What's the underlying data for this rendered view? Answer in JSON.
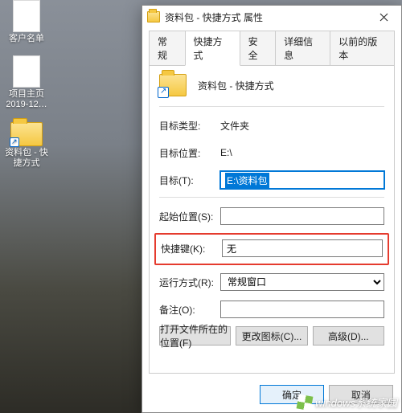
{
  "desktop": {
    "icons": [
      {
        "label": "客户名单"
      },
      {
        "label": "项目主页\n2019-12…"
      },
      {
        "label": "资料包 - 快\n捷方式"
      }
    ]
  },
  "dialog": {
    "title": "资料包 - 快捷方式 属性",
    "tabs": [
      "常规",
      "快捷方式",
      "安全",
      "详细信息",
      "以前的版本"
    ],
    "active_tab_index": 1,
    "header_name": "资料包 - 快捷方式",
    "fields": {
      "target_type_label": "目标类型:",
      "target_type_value": "文件夹",
      "target_location_label": "目标位置:",
      "target_location_value": "E:\\",
      "target_label": "目标(T):",
      "target_value": "E:\\资料包",
      "start_in_label": "起始位置(S):",
      "start_in_value": "",
      "hotkey_label": "快捷键(K):",
      "hotkey_value": "无",
      "run_label": "运行方式(R):",
      "run_value": "常规窗口",
      "comment_label": "备注(O):",
      "comment_value": ""
    },
    "panel_buttons": {
      "open_location": "打开文件所在的位置(F)",
      "change_icon": "更改图标(C)...",
      "advanced": "高级(D)..."
    },
    "footer": {
      "ok": "确定",
      "cancel": "取消"
    }
  },
  "watermark": "windows系统家园"
}
